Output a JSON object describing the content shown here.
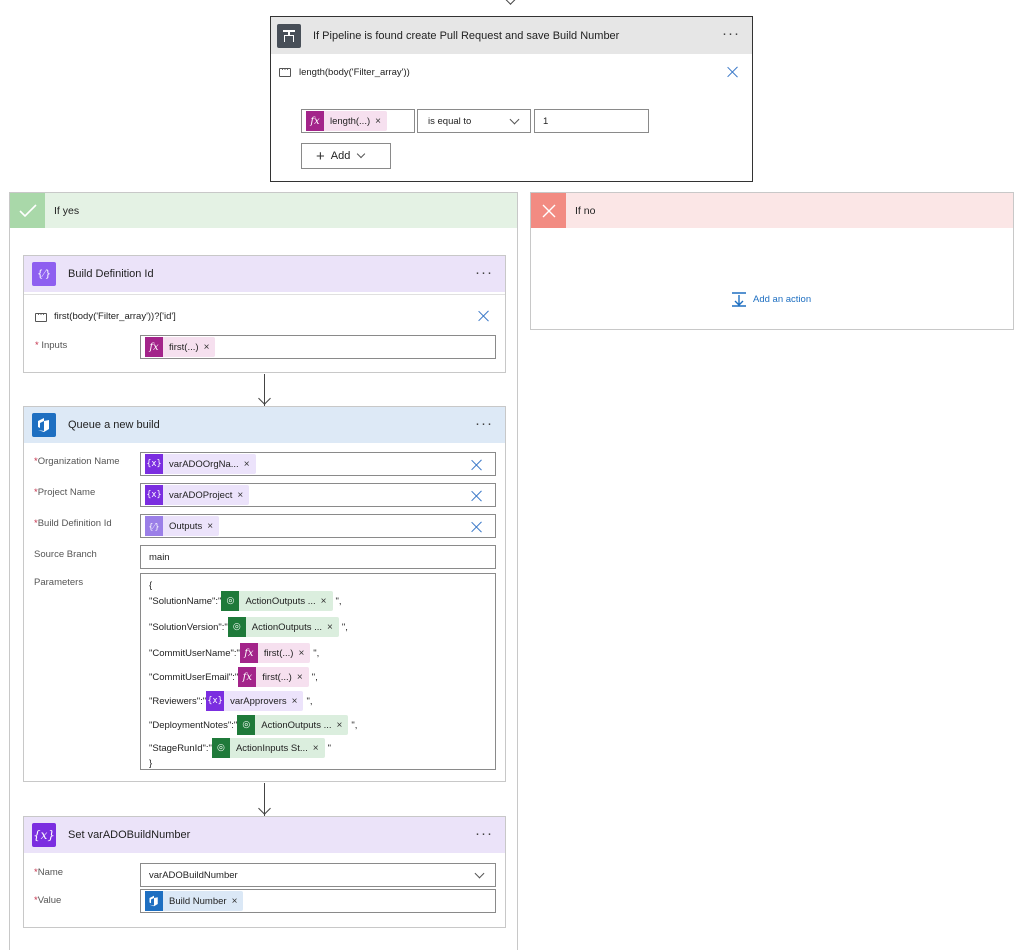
{
  "condition": {
    "title": "If Pipeline is found create Pull Request and save Build Number",
    "expression_comment": "length(body('Filter_array'))",
    "operand_token": "length(...)",
    "operator": "is equal to",
    "value": "1",
    "add_label": "Add"
  },
  "if_yes": {
    "label": "If yes"
  },
  "if_no": {
    "label": "If no",
    "add_action": "Add an action"
  },
  "build_def": {
    "title": "Build Definition Id",
    "comment": "first(body('Filter_array'))?['id']",
    "inputs_label": "Inputs",
    "inputs_token": "first(...)"
  },
  "queue": {
    "title": "Queue a new build",
    "org_label": "Organization Name",
    "org_token": "varADOOrgNa...",
    "project_label": "Project Name",
    "project_token": "varADOProject",
    "builddef_label": "Build Definition Id",
    "builddef_token": "Outputs",
    "branch_label": "Source Branch",
    "branch_value": "main",
    "params_label": "Parameters",
    "params_open": "{",
    "params_close": "}",
    "params": [
      {
        "key": "\"SolutionName\":\"",
        "token": "ActionOutputs ...",
        "kind": "pp"
      },
      {
        "key": "\"SolutionVersion\":\"",
        "token": "ActionOutputs ...",
        "kind": "pp"
      },
      {
        "key": "\"CommitUserName\":\"",
        "token": "first(...)",
        "kind": "fx"
      },
      {
        "key": "\"CommitUserEmail\":\"",
        "token": "first(...)",
        "kind": "fx"
      },
      {
        "key": "\"Reviewers\":\"",
        "token": "varApprovers",
        "kind": "var"
      },
      {
        "key": "\"DeploymentNotes\":\"",
        "token": "ActionOutputs ...",
        "kind": "pp"
      },
      {
        "key": "\"StageRunId\":\"",
        "token": "ActionInputs St...",
        "kind": "pp"
      }
    ],
    "params_suffix_comma": "\",",
    "params_suffix_last": "\""
  },
  "setvar": {
    "title": "Set varADOBuildNumber",
    "name_label": "Name",
    "name_value": "varADOBuildNumber",
    "value_label": "Value",
    "value_token": "Build Number"
  },
  "colors": {
    "condition_header": "#e6e6e6",
    "yes_header": "#e4f2e4",
    "no_header": "#fbe6e6",
    "variable_header": "#ebe3f9",
    "ado_header": "#dde9f6"
  }
}
